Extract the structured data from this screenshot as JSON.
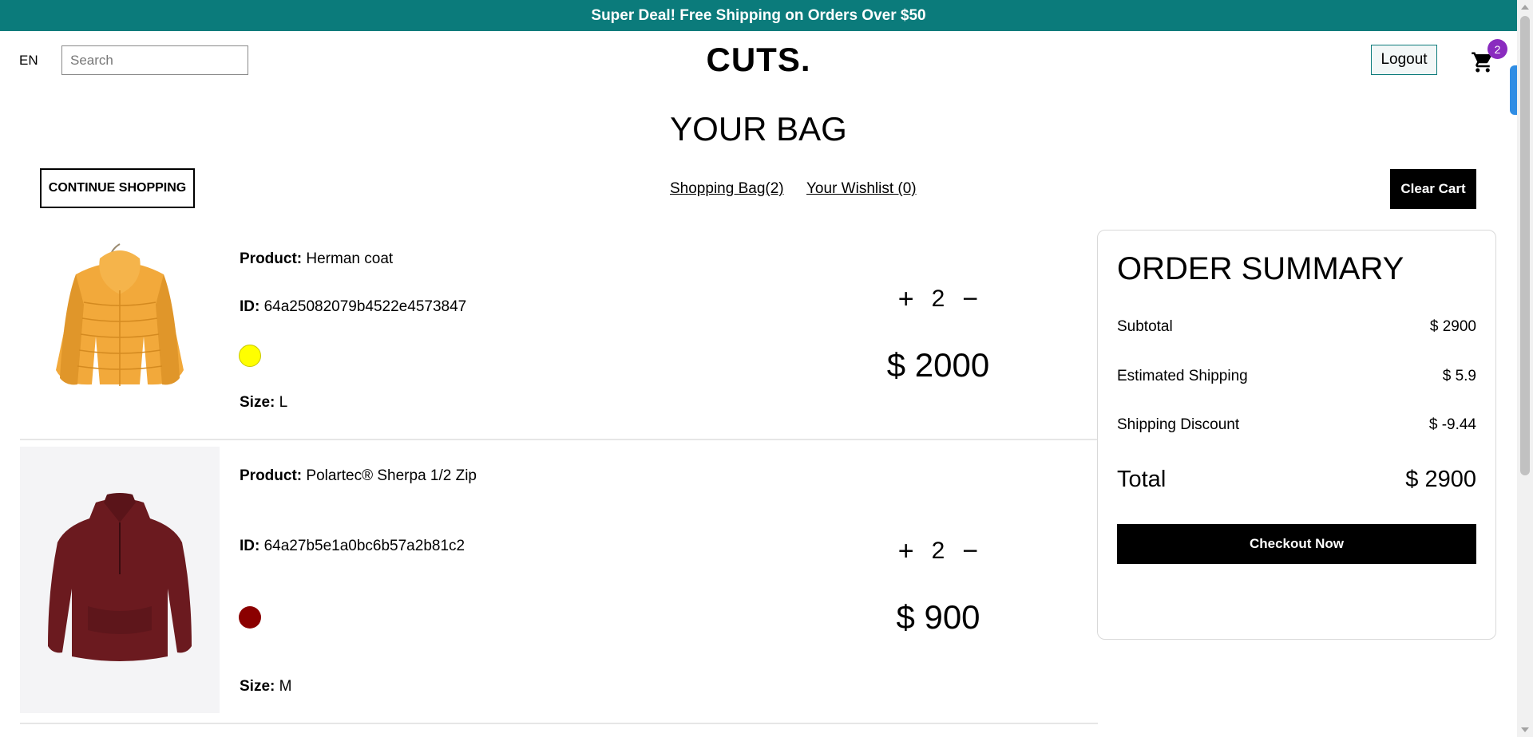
{
  "announcement": "Super Deal! Free Shipping on Orders Over $50",
  "navbar": {
    "language": "EN",
    "search_placeholder": "Search",
    "logo": "CUTS.",
    "logout_label": "Logout",
    "cart_count": "2"
  },
  "page": {
    "title": "YOUR BAG",
    "continue_label": "CONTINUE SHOPPING",
    "shopping_bag_label": "Shopping Bag(2)",
    "wishlist_label": "Your Wishlist (0)",
    "clear_cart_label": "Clear Cart"
  },
  "labels": {
    "product": "Product:",
    "id": "ID:",
    "size": "Size:",
    "plus": "+",
    "minus": "−"
  },
  "items": [
    {
      "product": "Herman coat",
      "id": "64a25082079b4522e4573847",
      "color": "#ffff00",
      "size": "L",
      "quantity": "2",
      "price": "$ 2000"
    },
    {
      "product": "Polartec® Sherpa 1/2 Zip",
      "id": "64a27b5e1a0bc6b57a2b81c2",
      "color": "#8b0000",
      "size": "M",
      "quantity": "2",
      "price": "$ 900"
    }
  ],
  "summary": {
    "title": "ORDER SUMMARY",
    "subtotal_label": "Subtotal",
    "subtotal_value": "$ 2900",
    "shipping_label": "Estimated Shipping",
    "shipping_value": "$ 5.9",
    "discount_label": "Shipping Discount",
    "discount_value": "$ -9.44",
    "total_label": "Total",
    "total_value": "$ 2900",
    "checkout_label": "Checkout Now"
  },
  "colors": {
    "announcement_bg": "#0b7b7b",
    "cart_badge": "#8a2bbf",
    "button_dark": "#000000"
  }
}
